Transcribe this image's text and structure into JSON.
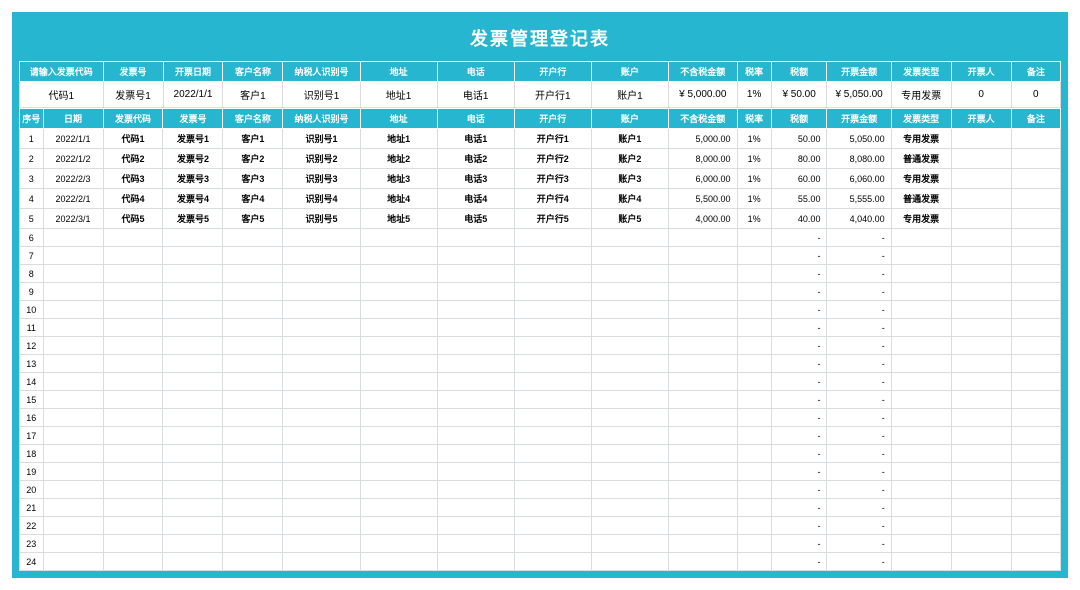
{
  "title": "发票管理登记表",
  "query_headers": [
    "请输入发票代码",
    "发票号",
    "开票日期",
    "客户名称",
    "纳税人识别号",
    "地址",
    "电话",
    "开户行",
    "账户",
    "不含税金额",
    "税率",
    "税额",
    "开票金额",
    "发票类型",
    "开票人",
    "备注"
  ],
  "query_row": [
    "代码1",
    "发票号1",
    "2022/1/1",
    "客户1",
    "识别号1",
    "地址1",
    "电话1",
    "开户行1",
    "账户1",
    "¥  5,000.00",
    "1%",
    "¥ 50.00",
    "¥    5,050.00",
    "专用发票",
    "0",
    "0"
  ],
  "list_headers": [
    "序号",
    "日期",
    "发票代码",
    "发票号",
    "客户名称",
    "纳税人识别号",
    "地址",
    "电话",
    "开户行",
    "账户",
    "不含税金额",
    "税率",
    "税额",
    "开票金额",
    "发票类型",
    "开票人",
    "备注"
  ],
  "rows": [
    {
      "seq": "1",
      "date": "2022/1/1",
      "code": "代码1",
      "num": "发票号1",
      "cust": "客户1",
      "taxid": "识别号1",
      "addr": "地址1",
      "tel": "电话1",
      "bank": "开户行1",
      "acct": "账户1",
      "amt": "5,000.00",
      "rate": "1%",
      "tax": "50.00",
      "total": "5,050.00",
      "type": "专用发票",
      "issuer": "",
      "note": ""
    },
    {
      "seq": "2",
      "date": "2022/1/2",
      "code": "代码2",
      "num": "发票号2",
      "cust": "客户2",
      "taxid": "识别号2",
      "addr": "地址2",
      "tel": "电话2",
      "bank": "开户行2",
      "acct": "账户2",
      "amt": "8,000.00",
      "rate": "1%",
      "tax": "80.00",
      "total": "8,080.00",
      "type": "普通发票",
      "issuer": "",
      "note": ""
    },
    {
      "seq": "3",
      "date": "2022/2/3",
      "code": "代码3",
      "num": "发票号3",
      "cust": "客户3",
      "taxid": "识别号3",
      "addr": "地址3",
      "tel": "电话3",
      "bank": "开户行3",
      "acct": "账户3",
      "amt": "6,000.00",
      "rate": "1%",
      "tax": "60.00",
      "total": "6,060.00",
      "type": "专用发票",
      "issuer": "",
      "note": ""
    },
    {
      "seq": "4",
      "date": "2022/2/1",
      "code": "代码4",
      "num": "发票号4",
      "cust": "客户4",
      "taxid": "识别号4",
      "addr": "地址4",
      "tel": "电话4",
      "bank": "开户行4",
      "acct": "账户4",
      "amt": "5,500.00",
      "rate": "1%",
      "tax": "55.00",
      "total": "5,555.00",
      "type": "普通发票",
      "issuer": "",
      "note": ""
    },
    {
      "seq": "5",
      "date": "2022/3/1",
      "code": "代码5",
      "num": "发票号5",
      "cust": "客户5",
      "taxid": "识别号5",
      "addr": "地址5",
      "tel": "电话5",
      "bank": "开户行5",
      "acct": "账户5",
      "amt": "4,000.00",
      "rate": "1%",
      "tax": "40.00",
      "total": "4,040.00",
      "type": "专用发票",
      "issuer": "",
      "note": ""
    }
  ],
  "empty_rows": 19,
  "chart_data": {
    "type": "table",
    "title": "发票管理登记表",
    "columns": [
      "序号",
      "日期",
      "发票代码",
      "发票号",
      "客户名称",
      "纳税人识别号",
      "地址",
      "电话",
      "开户行",
      "账户",
      "不含税金额",
      "税率",
      "税额",
      "开票金额",
      "发票类型"
    ],
    "data": [
      [
        1,
        "2022/1/1",
        "代码1",
        "发票号1",
        "客户1",
        "识别号1",
        "地址1",
        "电话1",
        "开户行1",
        "账户1",
        5000.0,
        0.01,
        50.0,
        5050.0,
        "专用发票"
      ],
      [
        2,
        "2022/1/2",
        "代码2",
        "发票号2",
        "客户2",
        "识别号2",
        "地址2",
        "电话2",
        "开户行2",
        "账户2",
        8000.0,
        0.01,
        80.0,
        8080.0,
        "普通发票"
      ],
      [
        3,
        "2022/2/3",
        "代码3",
        "发票号3",
        "客户3",
        "识别号3",
        "地址3",
        "电话3",
        "开户行3",
        "账户3",
        6000.0,
        0.01,
        60.0,
        6060.0,
        "专用发票"
      ],
      [
        4,
        "2022/2/1",
        "代码4",
        "发票号4",
        "客户4",
        "识别号4",
        "地址4",
        "电话4",
        "开户行4",
        "账户4",
        5500.0,
        0.01,
        55.0,
        5555.0,
        "普通发票"
      ],
      [
        5,
        "2022/3/1",
        "代码5",
        "发票号5",
        "客户5",
        "识别号5",
        "地址5",
        "电话5",
        "开户行5",
        "账户5",
        4000.0,
        0.01,
        40.0,
        4040.0,
        "专用发票"
      ]
    ]
  }
}
